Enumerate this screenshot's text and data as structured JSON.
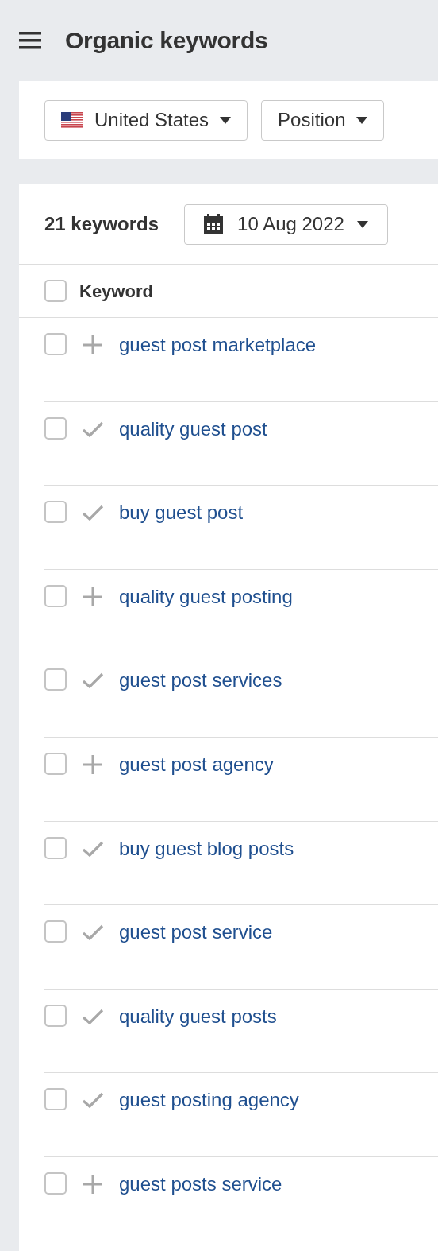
{
  "header": {
    "title": "Organic keywords"
  },
  "filters": [
    {
      "kind": "country",
      "label": "United States"
    },
    {
      "kind": "plain",
      "label": "Position"
    }
  ],
  "summary": {
    "count": "21 keywords",
    "date": "10 Aug 2022"
  },
  "table": {
    "column_header": "Keyword",
    "header_checked": false,
    "rows": [
      {
        "keyword": "guest post marketplace",
        "checked": false,
        "tracked": false
      },
      {
        "keyword": "quality guest post",
        "checked": false,
        "tracked": true
      },
      {
        "keyword": "buy guest post",
        "checked": false,
        "tracked": true
      },
      {
        "keyword": "quality guest posting",
        "checked": false,
        "tracked": false
      },
      {
        "keyword": "guest post services",
        "checked": false,
        "tracked": true
      },
      {
        "keyword": "guest post agency",
        "checked": false,
        "tracked": false
      },
      {
        "keyword": "buy guest blog posts",
        "checked": false,
        "tracked": true
      },
      {
        "keyword": "guest post service",
        "checked": false,
        "tracked": true
      },
      {
        "keyword": "quality guest posts",
        "checked": false,
        "tracked": true
      },
      {
        "keyword": "guest posting agency",
        "checked": false,
        "tracked": true
      },
      {
        "keyword": "guest posts service",
        "checked": false,
        "tracked": false
      }
    ]
  }
}
